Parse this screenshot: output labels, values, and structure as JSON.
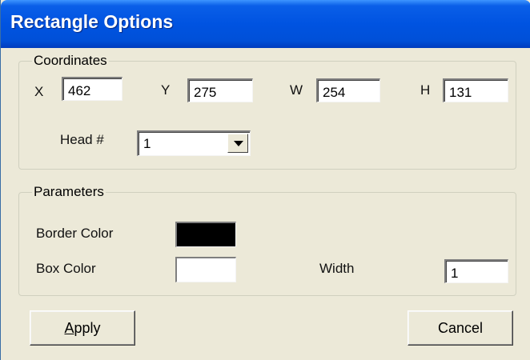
{
  "window": {
    "title": "Rectangle Options"
  },
  "coordinates": {
    "legend": "Coordinates",
    "x": {
      "label": "X",
      "value": "462"
    },
    "y": {
      "label": "Y",
      "value": "275"
    },
    "w": {
      "label": "W",
      "value": "254"
    },
    "h": {
      "label": "H",
      "value": "131"
    },
    "head": {
      "label": "Head #",
      "value": "1"
    }
  },
  "parameters": {
    "legend": "Parameters",
    "border_color": {
      "label": "Border Color",
      "color": "#000000"
    },
    "box_color": {
      "label": "Box Color",
      "color": "#ffffff"
    },
    "width": {
      "label": "Width",
      "value": "1"
    }
  },
  "buttons": {
    "apply_first": "A",
    "apply_rest": "pply",
    "cancel": "Cancel"
  }
}
